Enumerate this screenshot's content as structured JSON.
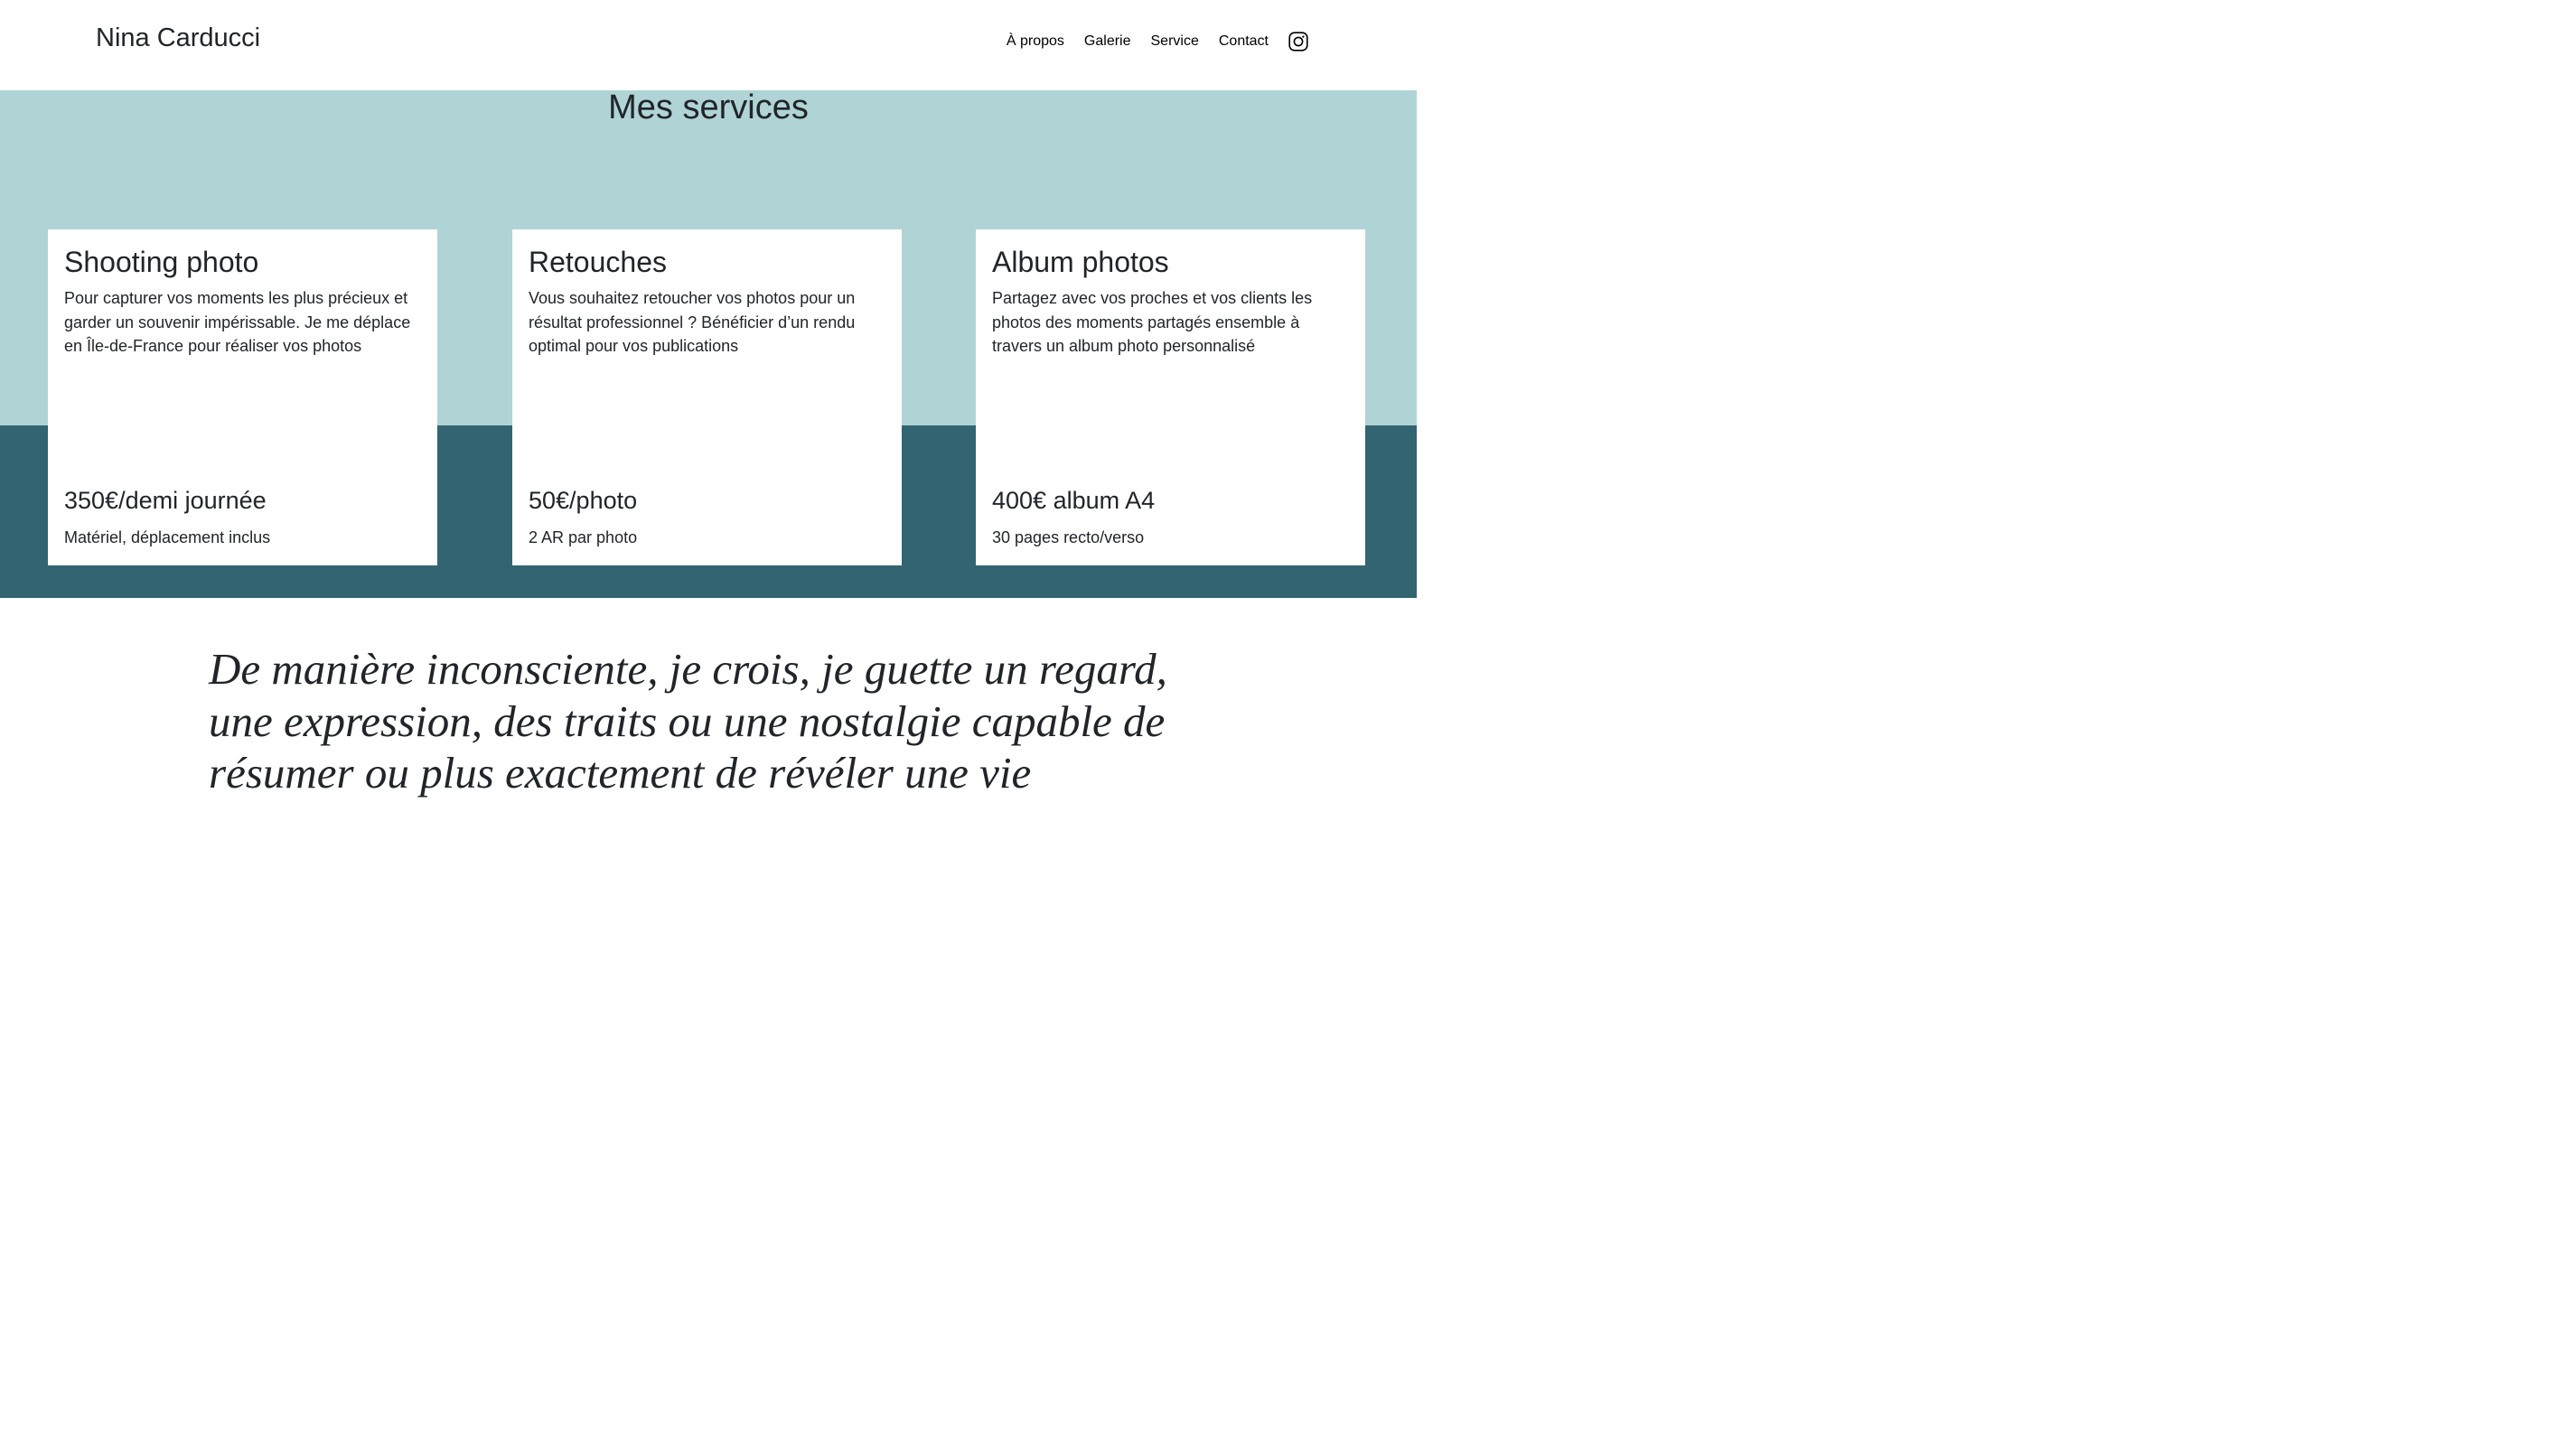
{
  "header": {
    "brand": "Nina Carducci",
    "nav": [
      {
        "label": "À propos"
      },
      {
        "label": "Galerie"
      },
      {
        "label": "Service"
      },
      {
        "label": "Contact"
      }
    ],
    "social_icon": "instagram-icon"
  },
  "services": {
    "title": "Mes services",
    "cards": [
      {
        "title": "Shooting photo",
        "description": "Pour capturer vos moments les plus précieux et garder un souvenir impérissable. Je me déplace en Île-de-France pour réaliser vos photos",
        "price": "350€/demi journée",
        "note": "Matériel, déplacement inclus"
      },
      {
        "title": "Retouches",
        "description": "Vous souhaitez retoucher vos photos pour un résultat professionnel ? Bénéficier d’un rendu optimal pour vos publications",
        "price": "50€/photo",
        "note": "2 AR par photo"
      },
      {
        "title": "Album photos",
        "description": "Partagez avec vos proches et vos clients les photos des moments partagés ensemble à travers un album photo personnalisé",
        "price": "400€ album A4",
        "note": "30 pages recto/verso"
      }
    ]
  },
  "quote": {
    "text": "De manière inconsciente, je crois, je guette un regard, une expression, des traits ou une nostalgie capable de résumer ou plus exactement de révéler une vie"
  },
  "colors": {
    "services_top": "#b0d4d6",
    "services_bottom": "#336472",
    "card_background": "#ffffff",
    "text": "#212529"
  }
}
